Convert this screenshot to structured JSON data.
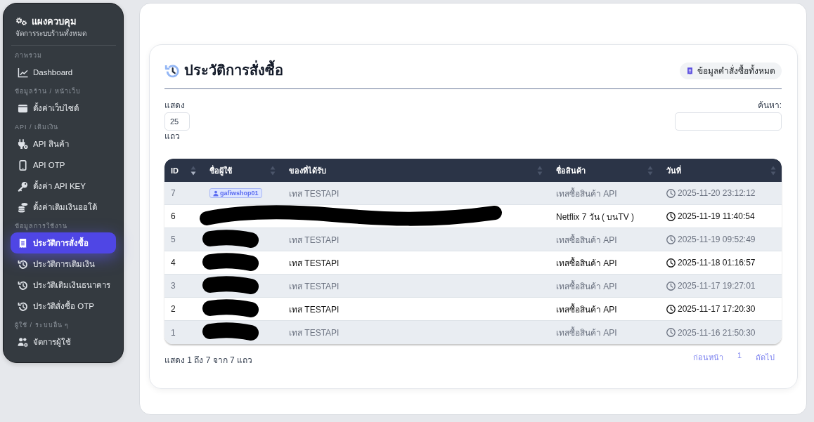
{
  "sidebar": {
    "title": "แผงควบคุม",
    "subtitle": "จัดการระบบร้านทั้งหมด",
    "sections": [
      {
        "heading": "ภาพรวม",
        "items": [
          {
            "label": "Dashboard",
            "selected": false
          }
        ]
      },
      {
        "heading": "ข้อมูลร้าน / หน้าเว็บ",
        "items": [
          {
            "label": "ตั้งค่าเว็บไซต์",
            "selected": false
          }
        ]
      },
      {
        "heading": "API / เติมเงิน",
        "items": [
          {
            "label": "API สินค้า",
            "selected": false
          },
          {
            "label": "API OTP",
            "selected": false
          },
          {
            "label": "ตั้งค่า API KEY",
            "selected": false
          },
          {
            "label": "ตั้งค่าเติมเงินออโต้",
            "selected": false
          }
        ]
      },
      {
        "heading": "ข้อมูลการใช้งาน",
        "items": [
          {
            "label": "ประวัติการสั่งซื้อ",
            "selected": true
          },
          {
            "label": "ประวัติการเติมเงิน",
            "selected": false
          },
          {
            "label": "ประวัติเติมเงินธนาคาร",
            "selected": false
          },
          {
            "label": "ประวัติสั่งซื้อ OTP",
            "selected": false
          }
        ]
      },
      {
        "heading": "ผู้ใช้ / ระบบอื่น ๆ",
        "items": [
          {
            "label": "จัดการผู้ใช้",
            "selected": false
          }
        ]
      }
    ]
  },
  "orders": {
    "title": "ประวัติการสั่งซื้อ",
    "all_orders_button": "ข้อมูลคำสั่งซื้อทั้งหมด",
    "length_label": "แสดง",
    "page_length": "25",
    "length_suffix": "แถว",
    "search_label": "ค้นหา:",
    "table": {
      "columns": [
        {
          "label": "ID",
          "sorted": true
        },
        {
          "label": "ชื่อผู้ใช้",
          "sorted": false
        },
        {
          "label": "ของที่ได้รับ",
          "sorted": false
        },
        {
          "label": "ชื่อสินค้า",
          "sorted": false
        },
        {
          "label": "วันที่",
          "sorted": false
        }
      ],
      "rows": [
        {
          "id": "7",
          "user": "gafiwshop01",
          "user_redacted": false,
          "item": "เทส TESTAPI",
          "item_redacted": false,
          "product": "เทสซื้อสินค้า API",
          "date": "2025-11-20 23:12:12"
        },
        {
          "id": "6",
          "user_redacted": true,
          "item_redacted": true,
          "product": "Netflix 7 วัน ( บนTV )",
          "date": "2025-11-19 11:40:54"
        },
        {
          "id": "5",
          "user_redacted": true,
          "item": "เทส TESTAPI",
          "item_redacted": false,
          "product": "เทสซื้อสินค้า API",
          "date": "2025-11-19 09:52:49"
        },
        {
          "id": "4",
          "user_redacted": true,
          "item": "เทส TESTAPI",
          "item_redacted": false,
          "product": "เทสซื้อสินค้า API",
          "date": "2025-11-18 01:16:57"
        },
        {
          "id": "3",
          "user_redacted": true,
          "item": "เทส TESTAPI",
          "item_redacted": false,
          "product": "เทสซื้อสินค้า API",
          "date": "2025-11-17 19:27:01"
        },
        {
          "id": "2",
          "user_redacted": true,
          "item": "เทส TESTAPI",
          "item_redacted": false,
          "product": "เทสซื้อสินค้า API",
          "date": "2025-11-17 17:20:30"
        },
        {
          "id": "1",
          "user_redacted": true,
          "item": "เทส TESTAPI",
          "item_redacted": false,
          "product": "เทสซื้อสินค้า API",
          "date": "2025-11-16 21:50:30"
        }
      ]
    },
    "summary": "แสดง 1 ถึง 7 จาก 7 แถว",
    "pagination": [
      "ก่อนหน้า",
      "1",
      "ถัดไป"
    ]
  }
}
